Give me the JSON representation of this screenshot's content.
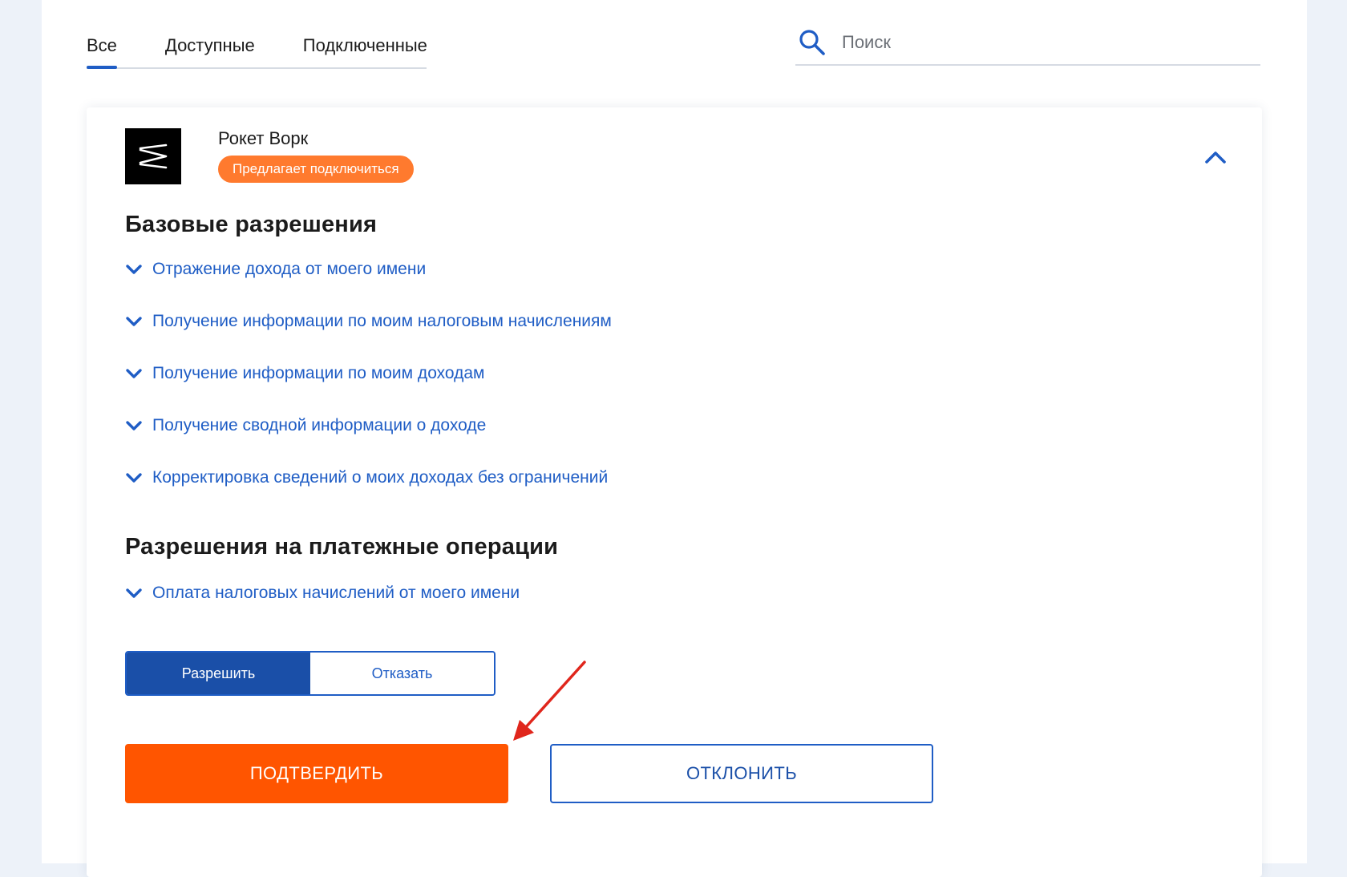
{
  "tabs": [
    {
      "label": "Все",
      "active": true
    },
    {
      "label": "Доступные",
      "active": false
    },
    {
      "label": "Подключенные",
      "active": false
    }
  ],
  "search": {
    "placeholder": "Поиск",
    "value": ""
  },
  "app": {
    "name": "Рокет Ворк",
    "status_badge": "Предлагает подключиться",
    "logo_icon": "rocket-work-logo-icon"
  },
  "sections": {
    "basic": {
      "title": "Базовые разрешения",
      "items": [
        "Отражение дохода от моего имени",
        "Получение информации по моим налоговым начислениям",
        "Получение информации по моим доходам",
        "Получение сводной информации о доходе",
        "Корректировка сведений о моих доходах без ограничений"
      ]
    },
    "payment": {
      "title": "Разрешения на платежные операции",
      "items": [
        "Оплата налоговых начислений от моего имени"
      ]
    }
  },
  "permission_toggle": {
    "allow": "Разрешить",
    "deny": "Отказать",
    "selected": "allow"
  },
  "actions": {
    "confirm": "ПОДТВЕРДИТЬ",
    "reject": "ОТКЛОНИТЬ"
  },
  "colors": {
    "accent_blue": "#1f5dc5",
    "toggle_blue": "#1a4fa8",
    "confirm_orange": "#ff5500",
    "badge_orange": "#ff7a2e",
    "annotation_red": "#e0261c",
    "background": "#edf2f9"
  }
}
